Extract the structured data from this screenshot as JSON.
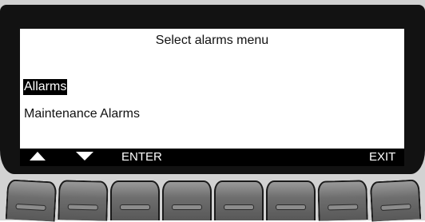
{
  "screen": {
    "title": "Select alarms menu",
    "menu": [
      {
        "label": "Allarms",
        "selected": true
      },
      {
        "label": "Maintenance Alarms",
        "selected": false
      }
    ]
  },
  "softkeys": {
    "up_icon": "triangle-up-icon",
    "down_icon": "triangle-down-icon",
    "enter_label": "ENTER",
    "exit_label": "EXIT"
  },
  "hardware_keys": {
    "count": 8,
    "color": "#6e6e6e"
  },
  "colors": {
    "bezel": "#121212",
    "screen": "#ffffff",
    "selection": "#000000"
  }
}
